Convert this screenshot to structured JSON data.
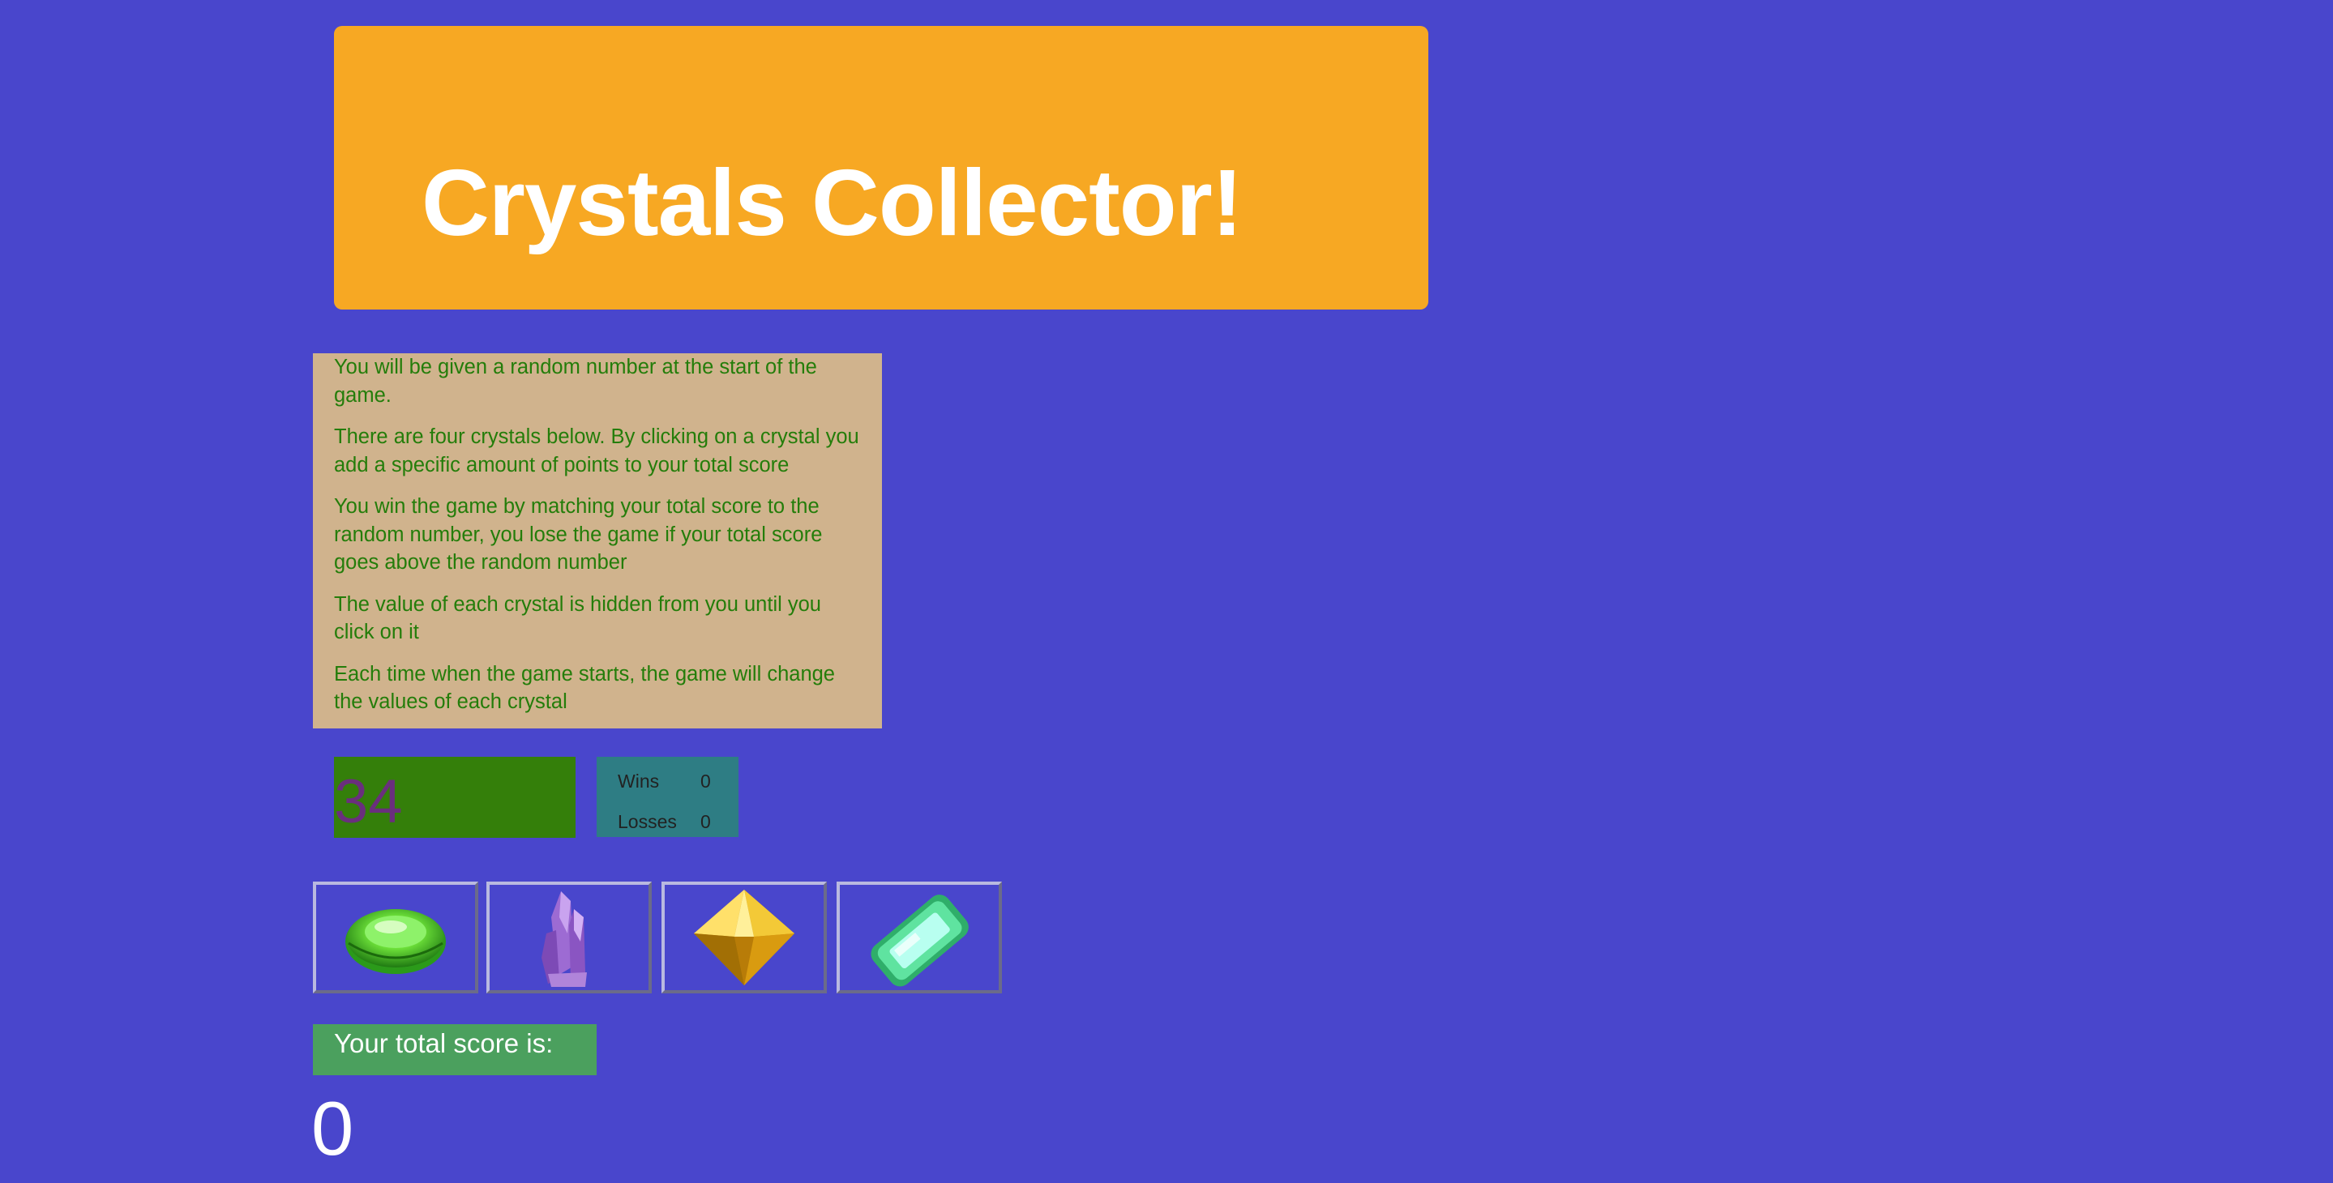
{
  "header": {
    "title": "Crystals Collector!"
  },
  "instructions": [
    "You will be given a random number at the start of the game.",
    "There are four crystals below. By clicking on a crystal you add a specific amount of points to your total score",
    "You win the game by matching your total score to the random number, you lose the game if your total score goes above the random number",
    "The value of each crystal is hidden from you until you click on it",
    "Each time when the game starts, the game will change the values of each crystal"
  ],
  "random_number": "34",
  "stats": {
    "wins_label": "Wins",
    "wins_value": "0",
    "losses_label": "Losses",
    "losses_value": "0"
  },
  "crystals": [
    {
      "icon": "green-oval-gem-icon",
      "color": "#5fd13a"
    },
    {
      "icon": "purple-amethyst-cluster-icon",
      "color": "#a56bd0"
    },
    {
      "icon": "yellow-octahedron-gem-icon",
      "color": "#e8b418"
    },
    {
      "icon": "green-emerald-cut-gem-icon",
      "color": "#5fe3a0"
    }
  ],
  "score": {
    "label": "Your total score is:",
    "value": "0"
  },
  "colors": {
    "background": "#4946cc",
    "header": "#f7a823",
    "instructions_bg": "#d0b38d",
    "instructions_text": "#247d0a",
    "random_bg": "#347f0a",
    "random_text": "#6a2f7d",
    "stats_bg": "#2e7d84",
    "score_label_bg": "#4ba05e"
  }
}
